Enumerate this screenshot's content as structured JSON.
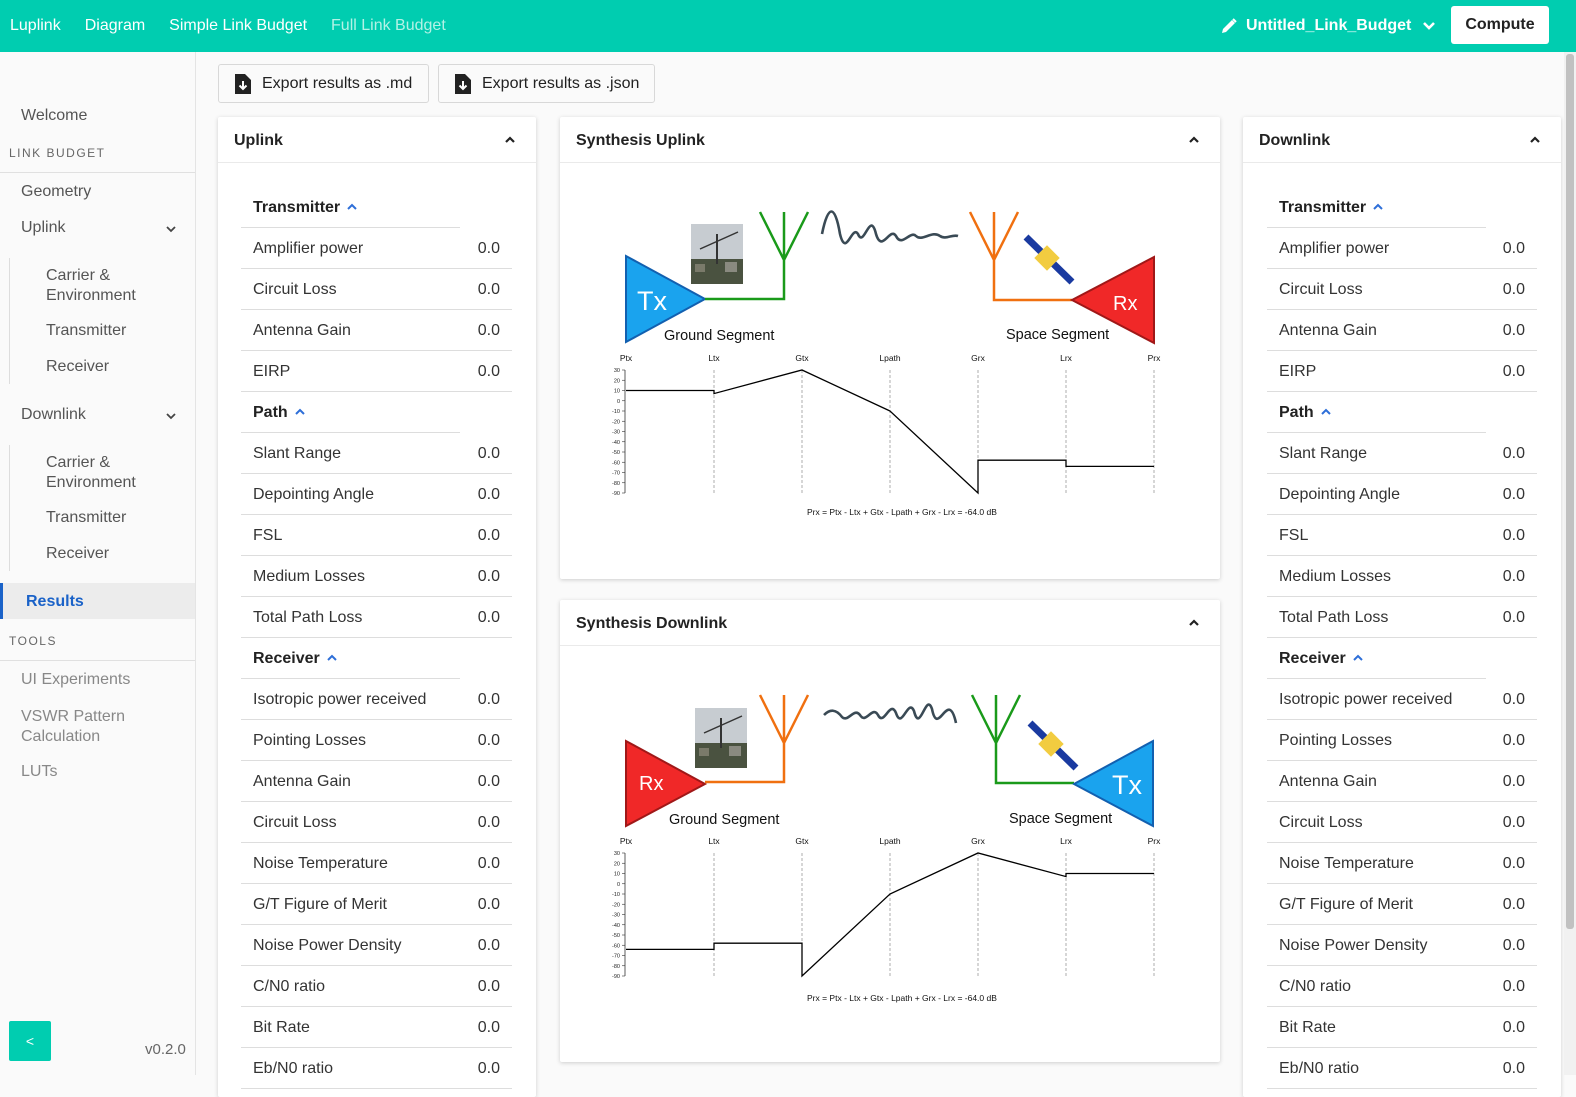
{
  "nav": {
    "brand": "Luplink",
    "links": [
      "Diagram",
      "Simple Link Budget",
      "Full Link Budget"
    ],
    "project_name": "Untitled_Link_Budget",
    "compute_label": "Compute"
  },
  "sidebar": {
    "welcome": "Welcome",
    "section_link_budget": "LINK BUDGET",
    "geometry": "Geometry",
    "uplink": "Uplink",
    "uplink_children": [
      "Carrier &\nEnvironment",
      "Transmitter",
      "Receiver"
    ],
    "downlink": "Downlink",
    "downlink_children": [
      "Carrier &\nEnvironment",
      "Transmitter",
      "Receiver"
    ],
    "results": "Results",
    "section_tools": "TOOLS",
    "tools": [
      "UI Experiments",
      "VSWR Pattern\nCalculation",
      "LUTs"
    ],
    "collapse_label": "<",
    "version": "v0.2.0"
  },
  "toolbar": {
    "export_md": "Export results as .md",
    "export_json": "Export results as .json"
  },
  "uplink_panel": {
    "title": "Uplink",
    "transmitter_title": "Transmitter",
    "transmitter": [
      {
        "label": "Amplifier power",
        "value": "0.0"
      },
      {
        "label": "Circuit Loss",
        "value": "0.0"
      },
      {
        "label": "Antenna Gain",
        "value": "0.0"
      },
      {
        "label": "EIRP",
        "value": "0.0"
      }
    ],
    "path_title": "Path",
    "path": [
      {
        "label": "Slant Range",
        "value": "0.0"
      },
      {
        "label": "Depointing Angle",
        "value": "0.0"
      },
      {
        "label": "FSL",
        "value": "0.0"
      },
      {
        "label": "Medium Losses",
        "value": "0.0"
      },
      {
        "label": "Total Path Loss",
        "value": "0.0"
      }
    ],
    "receiver_title": "Receiver",
    "receiver": [
      {
        "label": "Isotropic power received",
        "value": "0.0"
      },
      {
        "label": "Pointing Losses",
        "value": "0.0"
      },
      {
        "label": "Antenna Gain",
        "value": "0.0"
      },
      {
        "label": "Circuit Loss",
        "value": "0.0"
      },
      {
        "label": "Noise Temperature",
        "value": "0.0"
      },
      {
        "label": "G/T Figure of Merit",
        "value": "0.0"
      },
      {
        "label": "Noise Power Density",
        "value": "0.0"
      },
      {
        "label": "C/N0 ratio",
        "value": "0.0"
      },
      {
        "label": "Bit Rate",
        "value": "0.0"
      },
      {
        "label": "Eb/N0 ratio",
        "value": "0.0"
      }
    ]
  },
  "downlink_panel": {
    "title": "Downlink",
    "transmitter_title": "Transmitter",
    "transmitter": [
      {
        "label": "Amplifier power",
        "value": "0.0"
      },
      {
        "label": "Circuit Loss",
        "value": "0.0"
      },
      {
        "label": "Antenna Gain",
        "value": "0.0"
      },
      {
        "label": "EIRP",
        "value": "0.0"
      }
    ],
    "path_title": "Path",
    "path": [
      {
        "label": "Slant Range",
        "value": "0.0"
      },
      {
        "label": "Depointing Angle",
        "value": "0.0"
      },
      {
        "label": "FSL",
        "value": "0.0"
      },
      {
        "label": "Medium Losses",
        "value": "0.0"
      },
      {
        "label": "Total Path Loss",
        "value": "0.0"
      }
    ],
    "receiver_title": "Receiver",
    "receiver": [
      {
        "label": "Isotropic power received",
        "value": "0.0"
      },
      {
        "label": "Pointing Losses",
        "value": "0.0"
      },
      {
        "label": "Antenna Gain",
        "value": "0.0"
      },
      {
        "label": "Circuit Loss",
        "value": "0.0"
      },
      {
        "label": "Noise Temperature",
        "value": "0.0"
      },
      {
        "label": "G/T Figure of Merit",
        "value": "0.0"
      },
      {
        "label": "Noise Power Density",
        "value": "0.0"
      },
      {
        "label": "C/N0 ratio",
        "value": "0.0"
      },
      {
        "label": "Bit Rate",
        "value": "0.0"
      },
      {
        "label": "Eb/N0 ratio",
        "value": "0.0"
      }
    ]
  },
  "synthesis_uplink": {
    "title": "Synthesis Uplink",
    "left_block": "Tx",
    "right_block": "Rx",
    "ground_label": "Ground Segment",
    "space_label": "Space Segment",
    "formula": "Prx = Ptx - Ltx + Gtx - Lpath + Grx - Lrx = -64.0 dB"
  },
  "synthesis_downlink": {
    "title": "Synthesis Downlink",
    "left_block": "Rx",
    "right_block": "Tx",
    "ground_label": "Ground Segment",
    "space_label": "Space Segment",
    "formula": "Prx = Ptx - Ltx + Gtx - Lpath + Grx - Lrx = -64.0 dB"
  },
  "chart_data": [
    {
      "type": "line",
      "categories": [
        "Ptx",
        "Ltx",
        "Gtx",
        "Lpath",
        "Grx",
        "Lrx",
        "Prx"
      ],
      "x": [
        "Ptx",
        "Ltx",
        "Ltx",
        "Gtx",
        "Gtx",
        "Lpath",
        "Grx",
        "Grx",
        "Lrx",
        "Lrx",
        "Prx"
      ],
      "y": [
        10,
        10,
        7,
        30,
        30,
        -10,
        -90,
        -58,
        -58,
        -64,
        -64
      ],
      "ylim": [
        -90,
        30
      ],
      "yticks": [
        30,
        20,
        10,
        0,
        -10,
        -20,
        -30,
        -40,
        -50,
        -60,
        -70,
        -80,
        -90
      ],
      "title": "",
      "xlabel": "",
      "ylabel": ""
    },
    {
      "type": "line",
      "categories": [
        "Ptx",
        "Ltx",
        "Gtx",
        "Lpath",
        "Grx",
        "Lrx",
        "Prx"
      ],
      "x": [
        "Ptx",
        "Ltx",
        "Ltx",
        "Gtx",
        "Gtx",
        "Lpath",
        "Grx",
        "Grx",
        "Lrx",
        "Lrx",
        "Prx"
      ],
      "y": [
        -64,
        -64,
        -58,
        -58,
        -90,
        -10,
        30,
        30,
        7,
        10,
        10
      ],
      "ylim": [
        -90,
        30
      ],
      "yticks": [
        30,
        20,
        10,
        0,
        -10,
        -20,
        -30,
        -40,
        -50,
        -60,
        -70,
        -80,
        -90
      ],
      "title": "",
      "xlabel": "",
      "ylabel": ""
    }
  ]
}
